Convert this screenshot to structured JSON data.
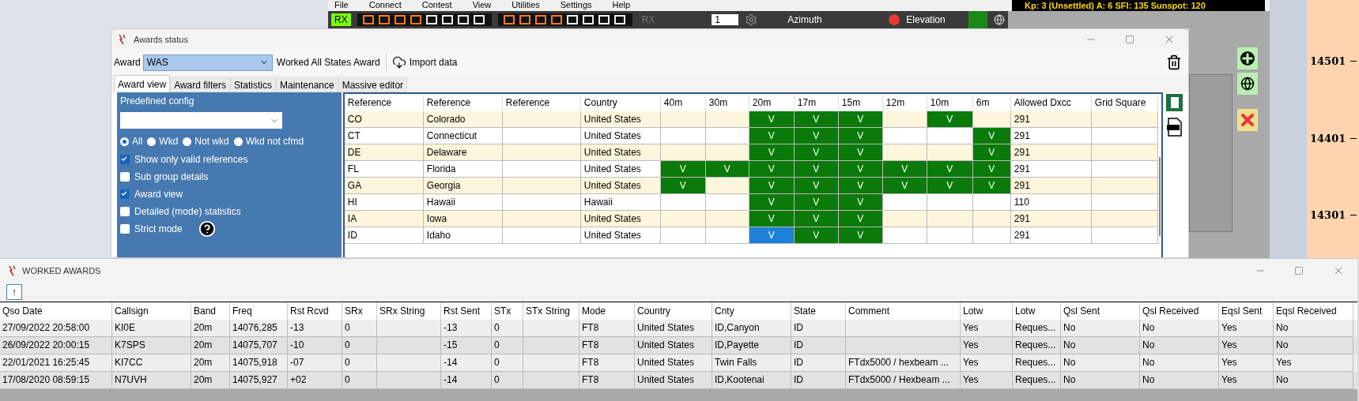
{
  "main_app": {
    "menu": [
      "File",
      "Connect",
      "Contest",
      "View",
      "Utilities",
      "Settings",
      "Help"
    ],
    "space_weather": "Kp: 3 (Unsettled)  A: 6  SFI: 135 Sunspot: 120",
    "rx_badges": [
      {
        "label": "RX",
        "active": true
      },
      {
        "label": "RX",
        "active": false
      }
    ],
    "rotator": {
      "spinner": "1",
      "azimuth_label": "Azimuth",
      "elevation_label": "Elevation"
    },
    "scale_labels": [
      "14501",
      "14401",
      "14301"
    ]
  },
  "awards_window": {
    "title": "Awards status",
    "award_label": "Award",
    "award_value": "WAS",
    "award_name": "Worked All States Award",
    "import_button": "Import data",
    "tabs": [
      {
        "label": "Award view",
        "selected": true
      },
      {
        "label": "Award filters",
        "selected": false
      },
      {
        "label": "Statistics",
        "selected": false
      },
      {
        "label": "Maintenance",
        "selected": false
      },
      {
        "label": "Massive editor",
        "selected": false
      }
    ],
    "predefined_config_label": "Predefined config",
    "filter_radios": [
      {
        "label": "All",
        "selected": true
      },
      {
        "label": "Wkd",
        "selected": false
      },
      {
        "label": "Not wkd",
        "selected": false
      },
      {
        "label": "Wkd not cfmd",
        "selected": false
      }
    ],
    "options": [
      {
        "label": "Show only valid references",
        "checked": true
      },
      {
        "label": "Sub group details",
        "checked": false
      },
      {
        "label": "Award view",
        "checked": true
      },
      {
        "label": "Detailed (mode) statistics",
        "checked": false
      },
      {
        "label": "Strict mode",
        "checked": false
      }
    ],
    "grid": {
      "columns": [
        "Reference",
        "Reference",
        "Reference",
        "Country",
        "40m",
        "30m",
        "20m",
        "17m",
        "15m",
        "12m",
        "10m",
        "6m",
        "Allowed Dxcc",
        "Grid Square"
      ],
      "rows": [
        {
          "ref": "CO",
          "name": "Colorado",
          "country": "United States",
          "bands": [
            {
              "worked": false,
              "selected": false
            },
            {
              "worked": false,
              "selected": false
            },
            {
              "worked": true,
              "mark": "V",
              "selected": false
            },
            {
              "worked": true,
              "mark": "V",
              "selected": false
            },
            {
              "worked": true,
              "mark": "V",
              "selected": false
            },
            {
              "worked": false,
              "selected": false
            },
            {
              "worked": true,
              "mark": "V",
              "selected": false
            },
            {
              "worked": false,
              "selected": false
            }
          ],
          "dxcc": "291"
        },
        {
          "ref": "CT",
          "name": "Connecticut",
          "country": "United States",
          "bands": [
            {
              "worked": false,
              "selected": false
            },
            {
              "worked": false,
              "selected": false
            },
            {
              "worked": true,
              "mark": "V",
              "selected": false
            },
            {
              "worked": true,
              "mark": "V",
              "selected": false
            },
            {
              "worked": true,
              "mark": "V",
              "selected": false
            },
            {
              "worked": false,
              "selected": false
            },
            {
              "worked": false,
              "selected": false
            },
            {
              "worked": true,
              "mark": "V",
              "selected": false
            }
          ],
          "dxcc": "291"
        },
        {
          "ref": "DE",
          "name": "Delaware",
          "country": "United States",
          "bands": [
            {
              "worked": false,
              "selected": false
            },
            {
              "worked": false,
              "selected": false
            },
            {
              "worked": true,
              "mark": "V",
              "selected": false
            },
            {
              "worked": true,
              "mark": "V",
              "selected": false
            },
            {
              "worked": true,
              "mark": "V",
              "selected": false
            },
            {
              "worked": false,
              "selected": false
            },
            {
              "worked": false,
              "selected": false
            },
            {
              "worked": true,
              "mark": "V",
              "selected": false
            }
          ],
          "dxcc": "291"
        },
        {
          "ref": "FL",
          "name": "Florida",
          "country": "United States",
          "bands": [
            {
              "worked": true,
              "mark": "V",
              "selected": false
            },
            {
              "worked": true,
              "mark": "V",
              "selected": false
            },
            {
              "worked": true,
              "mark": "V",
              "selected": false
            },
            {
              "worked": true,
              "mark": "V",
              "selected": false
            },
            {
              "worked": true,
              "mark": "V",
              "selected": false
            },
            {
              "worked": true,
              "mark": "V",
              "selected": false
            },
            {
              "worked": true,
              "mark": "V",
              "selected": false
            },
            {
              "worked": true,
              "mark": "V",
              "selected": false
            }
          ],
          "dxcc": "291"
        },
        {
          "ref": "GA",
          "name": "Georgia",
          "country": "United States",
          "bands": [
            {
              "worked": true,
              "mark": "V",
              "selected": false
            },
            {
              "worked": false,
              "selected": false
            },
            {
              "worked": true,
              "mark": "V",
              "selected": false
            },
            {
              "worked": true,
              "mark": "V",
              "selected": false
            },
            {
              "worked": true,
              "mark": "V",
              "selected": false
            },
            {
              "worked": true,
              "mark": "V",
              "selected": false
            },
            {
              "worked": true,
              "mark": "V",
              "selected": false
            },
            {
              "worked": true,
              "mark": "V",
              "selected": false
            }
          ],
          "dxcc": "291"
        },
        {
          "ref": "HI",
          "name": "Hawaii",
          "country": "Hawaii",
          "bands": [
            {
              "worked": false,
              "selected": false
            },
            {
              "worked": false,
              "selected": false
            },
            {
              "worked": true,
              "mark": "V",
              "selected": false
            },
            {
              "worked": true,
              "mark": "V",
              "selected": false
            },
            {
              "worked": true,
              "mark": "V",
              "selected": false
            },
            {
              "worked": false,
              "selected": false
            },
            {
              "worked": false,
              "selected": false
            },
            {
              "worked": false,
              "selected": false
            }
          ],
          "dxcc": "110"
        },
        {
          "ref": "IA",
          "name": "Iowa",
          "country": "United States",
          "bands": [
            {
              "worked": false,
              "selected": false
            },
            {
              "worked": false,
              "selected": false
            },
            {
              "worked": true,
              "mark": "V",
              "selected": false
            },
            {
              "worked": true,
              "mark": "V",
              "selected": false
            },
            {
              "worked": true,
              "mark": "V",
              "selected": false
            },
            {
              "worked": false,
              "selected": false
            },
            {
              "worked": false,
              "selected": false
            },
            {
              "worked": false,
              "selected": false
            }
          ],
          "dxcc": "291"
        },
        {
          "ref": "ID",
          "name": "Idaho",
          "country": "United States",
          "bands": [
            {
              "worked": false,
              "selected": false
            },
            {
              "worked": false,
              "selected": false
            },
            {
              "worked": true,
              "mark": "V",
              "selected": true
            },
            {
              "worked": true,
              "mark": "V",
              "selected": false
            },
            {
              "worked": true,
              "mark": "V",
              "selected": false
            },
            {
              "worked": false,
              "selected": false
            },
            {
              "worked": false,
              "selected": false
            },
            {
              "worked": false,
              "selected": false
            }
          ],
          "dxcc": "291"
        }
      ]
    }
  },
  "worked_window": {
    "title": "WORKED AWARDS",
    "up_button": "↑",
    "table": {
      "columns": [
        "Qso Date",
        "Callsign",
        "Band",
        "Freq",
        "Rst Rcvd",
        "SRx",
        "SRx String",
        "Rst Sent",
        "STx",
        "STx String",
        "Mode",
        "Country",
        "Cnty",
        "State",
        "Comment",
        "Lotw",
        "Lotw",
        "Qsl Sent",
        "Qsl Received",
        "Eqsl Sent",
        "Eqsl Received"
      ],
      "rows": [
        [
          "27/09/2022 20:58:00",
          "KI0E",
          "20m",
          "14076,285",
          "-13",
          "0",
          "",
          "-13",
          "0",
          "",
          "FT8",
          "United States",
          "ID,Canyon",
          "ID",
          "",
          "Yes",
          "Reques...",
          "No",
          "No",
          "Yes",
          "No"
        ],
        [
          "26/09/2022 20:00:15",
          "K7SPS",
          "20m",
          "14075,707",
          "-10",
          "0",
          "",
          "-15",
          "0",
          "",
          "FT8",
          "United States",
          "ID,Payette",
          "ID",
          "",
          "Yes",
          "Reques...",
          "No",
          "No",
          "Yes",
          "No"
        ],
        [
          "22/01/2021 16:25:45",
          "KI7CC",
          "20m",
          "14075,918",
          "-07",
          "0",
          "",
          "-14",
          "0",
          "",
          "FT8",
          "United States",
          "Twin Falls",
          "ID",
          "FTdx5000 / hexbeam ...",
          "Yes",
          "Reques...",
          "No",
          "No",
          "Yes",
          "Yes"
        ],
        [
          "17/08/2020 08:59:15",
          "N7UVH",
          "20m",
          "14075,927",
          "+02",
          "0",
          "",
          "-14",
          "0",
          "",
          "FT8",
          "United States",
          "ID,Kootenai",
          "ID",
          "FTdx5000 / Hexbeam ...",
          "Yes",
          "Reques...",
          "No",
          "No",
          "Yes",
          "No"
        ]
      ]
    }
  }
}
